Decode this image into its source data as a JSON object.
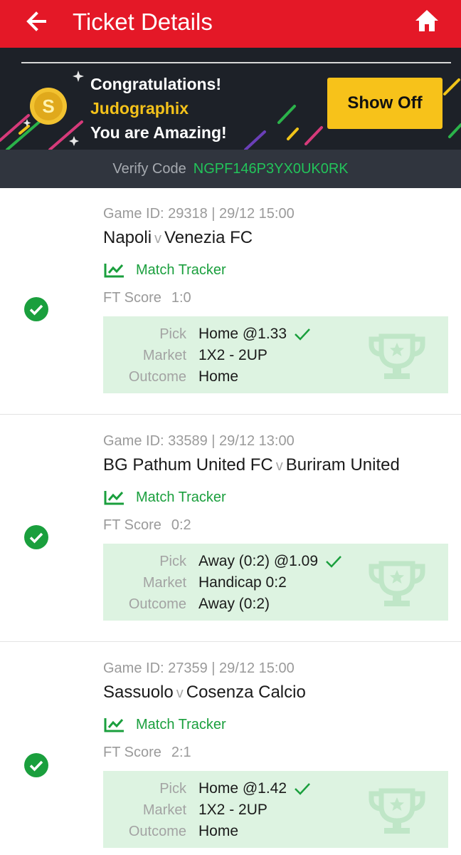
{
  "header": {
    "title": "Ticket Details",
    "back_icon": "back-arrow-icon",
    "home_icon": "home-icon",
    "bg_color": "#e41827"
  },
  "banner": {
    "congrats": "Congratulations!",
    "username": "Judographix",
    "message": "You are Amazing!",
    "show_off_label": "Show Off",
    "coin_icon": "coin-icon"
  },
  "verify": {
    "label": "Verify Code",
    "code": "NGPF146P3YX0UK0RK"
  },
  "bets": [
    {
      "game_meta": "Game ID: 29318 | 29/12 15:00",
      "home": "Napoli",
      "vs": "v",
      "away": "Venezia FC",
      "tracker_label": "Match Tracker",
      "ft_label": "FT Score",
      "ft_score": "1:0",
      "pick_label": "Pick",
      "pick": "Home @1.33",
      "market_label": "Market",
      "market": "1X2 - 2UP",
      "outcome_label": "Outcome",
      "outcome": "Home"
    },
    {
      "game_meta": "Game ID: 33589 | 29/12 13:00",
      "home": "BG Pathum United FC",
      "vs": "v",
      "away": "Buriram United",
      "tracker_label": "Match Tracker",
      "ft_label": "FT Score",
      "ft_score": "0:2",
      "pick_label": "Pick",
      "pick": "Away (0:2) @1.09",
      "market_label": "Market",
      "market": "Handicap 0:2",
      "outcome_label": "Outcome",
      "outcome": "Away (0:2)"
    },
    {
      "game_meta": "Game ID: 27359 | 29/12 15:00",
      "home": "Sassuolo",
      "vs": "v",
      "away": "Cosenza Calcio",
      "tracker_label": "Match Tracker",
      "ft_label": "FT Score",
      "ft_score": "2:1",
      "pick_label": "Pick",
      "pick": "Home @1.42",
      "market_label": "Market",
      "market": "1X2 - 2UP",
      "outcome_label": "Outcome",
      "outcome": "Home"
    }
  ],
  "colors": {
    "win_green": "#1a9f3d",
    "pick_bg": "#ddf3e1",
    "accent_yellow": "#f7c21a"
  }
}
